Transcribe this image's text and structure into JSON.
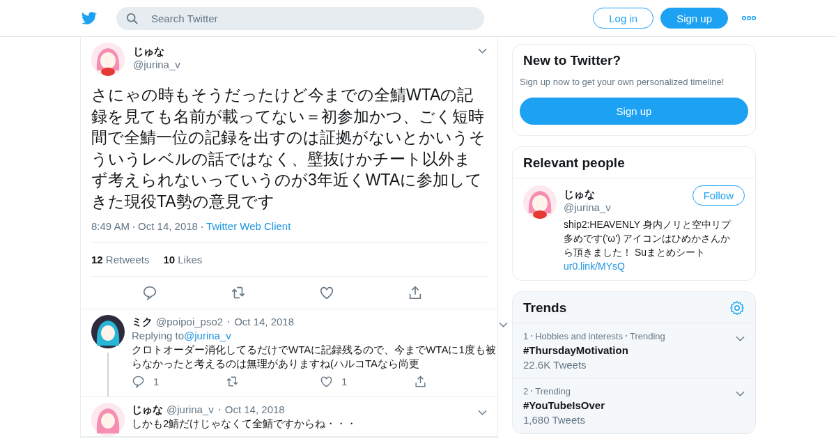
{
  "header": {
    "search_placeholder": "Search Twitter",
    "login": "Log in",
    "signup": "Sign up"
  },
  "tweet": {
    "name": "じゅな",
    "handle": "@jurina_v",
    "text": "さにゃの時もそうだったけど今までの全鯖WTAの記録を見ても名前が載ってない＝初参加かつ、ごく短時間で全鯖一位の記録を出すのは証拠がないとかいうそういうレベルの話ではなく、壁抜けかチート以外まず考えられないっていうのが3年近くWTAに参加してきた現役TA勢の意見です",
    "time": "8:49 AM",
    "date": "Oct 14, 2018",
    "source": "Twitter Web Client",
    "retweets_count": "12",
    "retweets_label": "Retweets",
    "likes_count": "10",
    "likes_label": "Likes"
  },
  "replies": [
    {
      "name": "ミク",
      "handle": "@poipoi_pso2",
      "date": "Oct 14, 2018",
      "replying_label": "Replying to",
      "replying_to": "@jurina_v",
      "text": "クロトオーダー消化してるだけでWTAに記録残るので、今までWTAに1度も被らなかったと考えるのは無理がありますね(ハルコTAなら尚更",
      "reply_count": "1",
      "like_count": "1",
      "thread": true
    },
    {
      "name": "じゅな",
      "handle": "@jurina_v",
      "date": "Oct 14, 2018",
      "text": "しかも2鯖だけじゃなくて全鯖ですからね・・・",
      "thread": false
    }
  ],
  "new_to_twitter": {
    "title": "New to Twitter?",
    "text": "Sign up now to get your own personalized timeline!",
    "button": "Sign up"
  },
  "relevant_people": {
    "title": "Relevant people",
    "people": [
      {
        "name": "じゅな",
        "handle": "@jurina_v",
        "follow": "Follow",
        "bio": "ship2:HEAVENLY 身内ノリと空中リプ多めです('ω') アイコンはひめかさんから頂きました！ Suまとめシート",
        "link": "ur0.link/MYsQ"
      }
    ]
  },
  "trends": {
    "title": "Trends",
    "items": [
      {
        "rank": "1",
        "context": "Hobbies and interests",
        "status": "Trending",
        "tag": "#ThursdayMotivation",
        "count": "22.6K Tweets"
      },
      {
        "rank": "2",
        "status": "Trending",
        "tag": "#YouTubeIsOver",
        "count": "1,680 Tweets"
      }
    ]
  }
}
